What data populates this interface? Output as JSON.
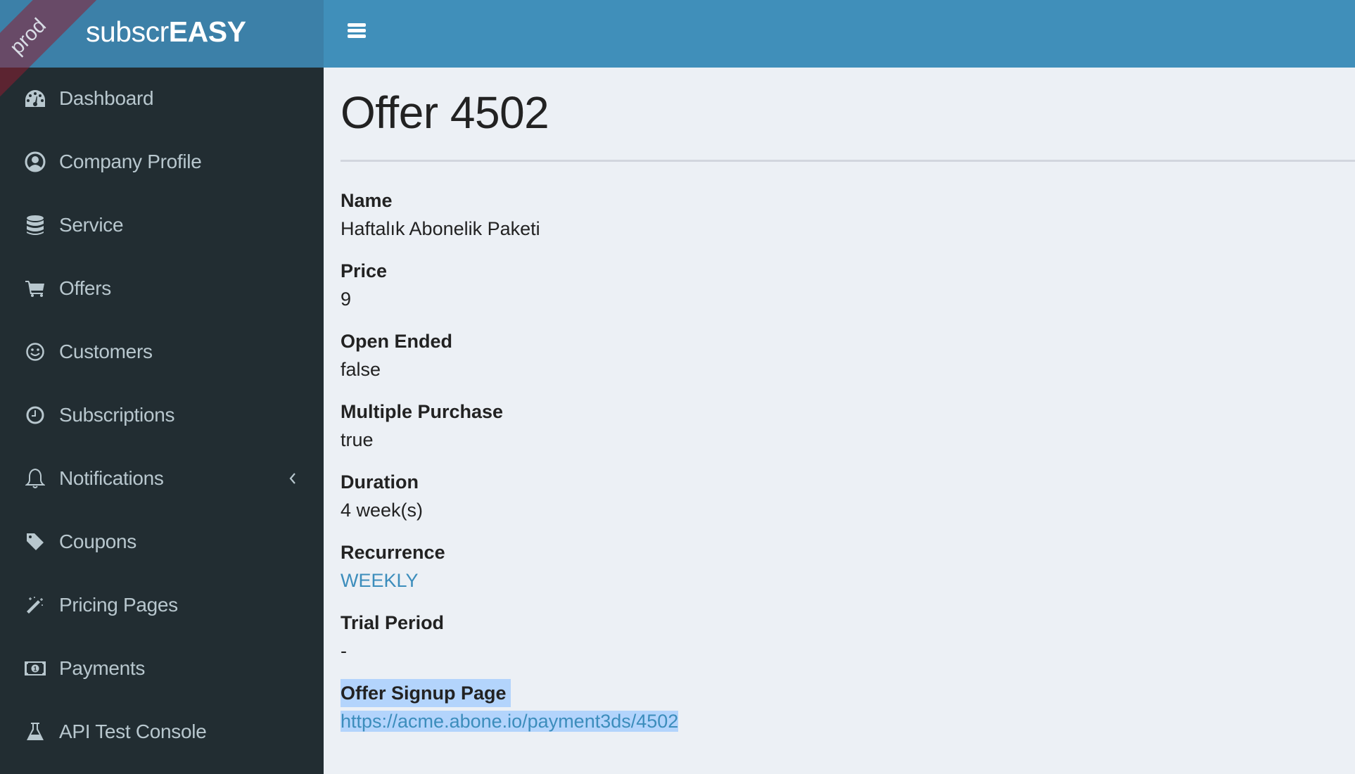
{
  "app": {
    "logo_light": "subscr",
    "logo_bold": "EASY",
    "environment_ribbon": "prod",
    "colors": {
      "header": "#408fba",
      "logo_bg": "#3c80a8",
      "sidebar_bg": "#222d32",
      "sidebar_text": "#b8c7ce",
      "content_bg": "#ecf0f5",
      "link": "#3c8dbc",
      "selection": "#b3d4fc"
    }
  },
  "header": {
    "menu_toggle_icon": "hamburger-icon"
  },
  "sidebar": {
    "items": [
      {
        "label": "Dashboard",
        "icon": "dashboard-gauge-icon"
      },
      {
        "label": "Company Profile",
        "icon": "user-circle-icon"
      },
      {
        "label": "Service",
        "icon": "database-icon"
      },
      {
        "label": "Offers",
        "icon": "shopping-cart-icon"
      },
      {
        "label": "Customers",
        "icon": "smile-icon"
      },
      {
        "label": "Subscriptions",
        "icon": "clock-icon"
      },
      {
        "label": "Notifications",
        "icon": "bell-icon",
        "expandable": true,
        "chevron_icon": "chevron-left-icon"
      },
      {
        "label": "Coupons",
        "icon": "tag-icon"
      },
      {
        "label": "Pricing Pages",
        "icon": "magic-wand-icon"
      },
      {
        "label": "Payments",
        "icon": "money-bill-icon"
      },
      {
        "label": "API Test Console",
        "icon": "flask-icon"
      }
    ]
  },
  "main": {
    "title": "Offer 4502",
    "fields": [
      {
        "label": "Name",
        "value": "Haftalık Abonelik Paketi"
      },
      {
        "label": "Price",
        "value": "9"
      },
      {
        "label": "Open Ended",
        "value": "false"
      },
      {
        "label": "Multiple Purchase",
        "value": "true"
      },
      {
        "label": "Duration",
        "value": "4 week(s)"
      },
      {
        "label": "Recurrence",
        "value": "WEEKLY",
        "is_link": true
      },
      {
        "label": "Trial Period",
        "value": "-"
      },
      {
        "label": "Offer Signup Page",
        "value": "https://acme.abone.io/payment3ds/4502",
        "is_link": true,
        "selected": true
      }
    ]
  }
}
